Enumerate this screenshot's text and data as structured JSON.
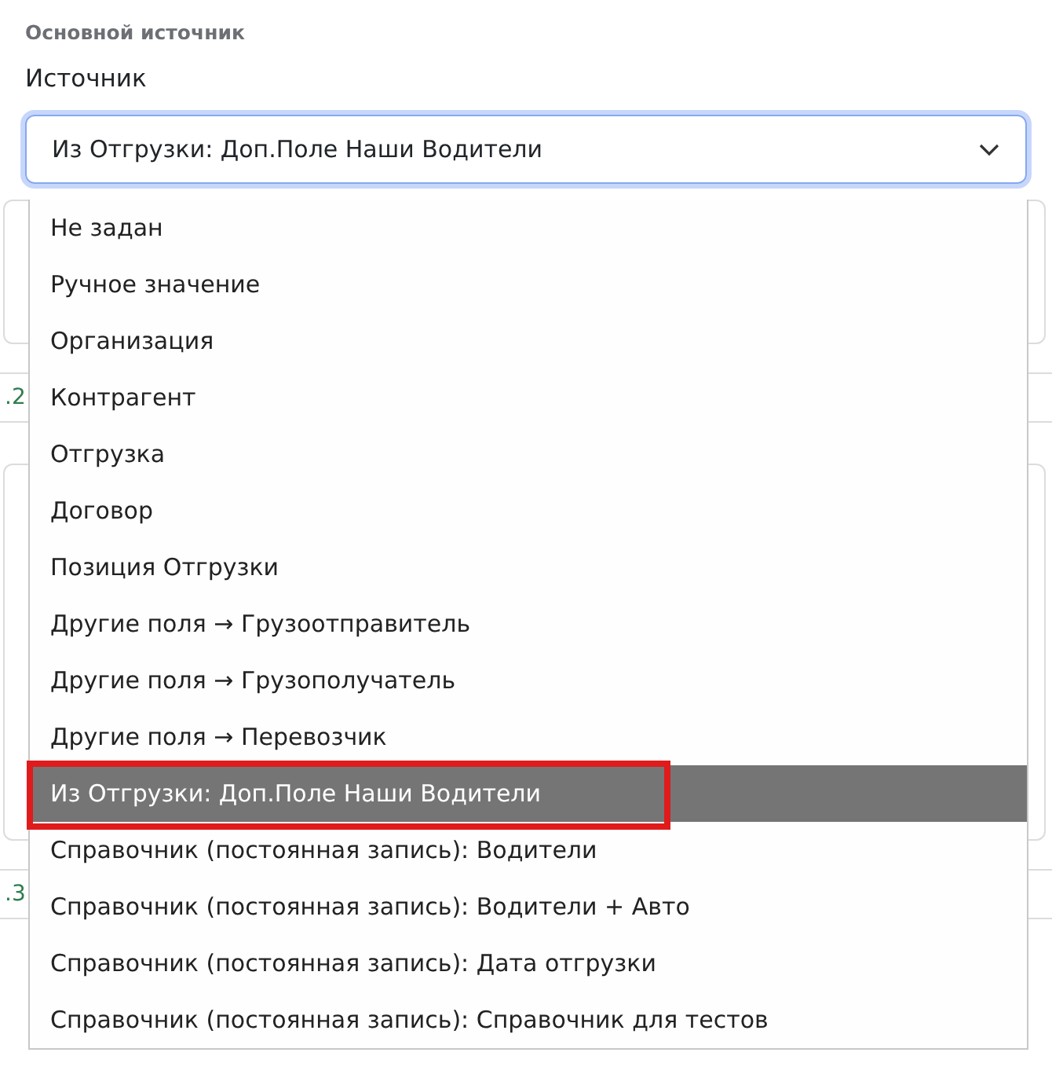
{
  "section_title": "Основной источник",
  "field_label": "Источник",
  "select": {
    "value": "Из Отгрузки: Доп.Поле Наши Водители"
  },
  "background_items": [
    {
      "number": ".2"
    },
    {
      "number": ".3"
    }
  ],
  "options": [
    {
      "label": "Не задан",
      "selected": false,
      "highlighted": false
    },
    {
      "label": "Ручное значение",
      "selected": false,
      "highlighted": false
    },
    {
      "label": "Организация",
      "selected": false,
      "highlighted": false
    },
    {
      "label": "Контрагент",
      "selected": false,
      "highlighted": false
    },
    {
      "label": "Отгрузка",
      "selected": false,
      "highlighted": false
    },
    {
      "label": "Договор",
      "selected": false,
      "highlighted": false
    },
    {
      "label": "Позиция Отгрузки",
      "selected": false,
      "highlighted": false
    },
    {
      "label": "Другие поля → Грузоотправитель",
      "selected": false,
      "highlighted": false
    },
    {
      "label": "Другие поля → Грузополучатель",
      "selected": false,
      "highlighted": false
    },
    {
      "label": "Другие поля → Перевозчик",
      "selected": false,
      "highlighted": false
    },
    {
      "label": "Из Отгрузки: Доп.Поле Наши Водители",
      "selected": true,
      "highlighted": true
    },
    {
      "label": "Справочник (постоянная запись): Водители",
      "selected": false,
      "highlighted": false
    },
    {
      "label": "Справочник (постоянная запись): Водители + Авто",
      "selected": false,
      "highlighted": false
    },
    {
      "label": "Справочник (постоянная запись): Дата отгрузки",
      "selected": false,
      "highlighted": false
    },
    {
      "label": "Справочник (постоянная запись): Справочник для тестов",
      "selected": false,
      "highlighted": false
    }
  ]
}
